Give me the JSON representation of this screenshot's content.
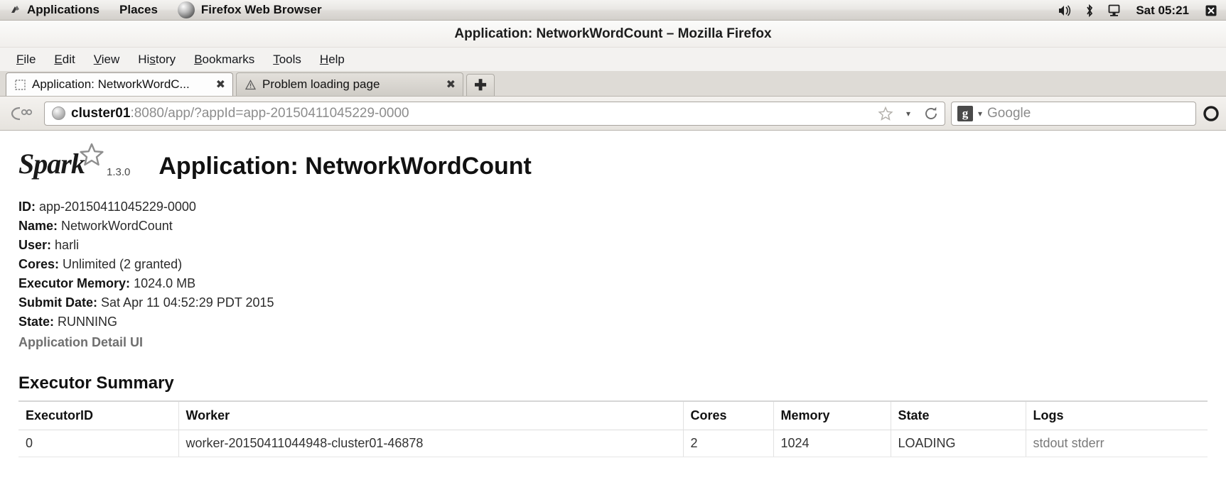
{
  "desktop": {
    "applications_label": "Applications",
    "places_label": "Places",
    "firefox_label": "Firefox Web Browser",
    "clock": "Sat 05:21",
    "tray": [
      {
        "name": "volume-icon"
      },
      {
        "name": "bluetooth-icon"
      },
      {
        "name": "display-icon"
      }
    ]
  },
  "window": {
    "title": "Application: NetworkWordCount – Mozilla Firefox"
  },
  "menubar": [
    {
      "label": "File",
      "accel": "F"
    },
    {
      "label": "Edit",
      "accel": "E"
    },
    {
      "label": "View",
      "accel": "V"
    },
    {
      "label": "History",
      "accel": "s"
    },
    {
      "label": "Bookmarks",
      "accel": "B"
    },
    {
      "label": "Tools",
      "accel": "T"
    },
    {
      "label": "Help",
      "accel": "H"
    }
  ],
  "tabs": [
    {
      "label": "Application: NetworkWordC...",
      "active": true,
      "favicon": "blank-page-icon",
      "close": "✖"
    },
    {
      "label": "Problem loading page",
      "active": false,
      "favicon": "warning-icon",
      "close": "✖"
    }
  ],
  "newtab_label": "✚",
  "navbar": {
    "back_icon": "back-arrow-icon",
    "url_host": "cluster01",
    "url_rest": ":8080/app/?appId=app-20150411045229-0000",
    "bookmark_icon": "star-icon",
    "dropdown_icon": "chevron-down-icon",
    "reload_icon": "reload-icon",
    "search_engine": "g",
    "search_placeholder": "Google"
  },
  "spark": {
    "logo_word": "Spark",
    "version": "1.3.0",
    "page_title": "Application: NetworkWordCount"
  },
  "app_info": [
    {
      "key": "ID:",
      "value": "app-20150411045229-0000"
    },
    {
      "key": "Name:",
      "value": "NetworkWordCount"
    },
    {
      "key": "User:",
      "value": "harli"
    },
    {
      "key": "Cores:",
      "value": "Unlimited (2 granted)"
    },
    {
      "key": "Executor Memory:",
      "value": "1024.0 MB"
    },
    {
      "key": "Submit Date:",
      "value": "Sat Apr 11 04:52:29 PDT 2015"
    },
    {
      "key": "State:",
      "value": "RUNNING"
    }
  ],
  "detail_ui_link": "Application Detail UI",
  "executor_summary": {
    "title": "Executor Summary",
    "columns": [
      "ExecutorID",
      "Worker",
      "Cores",
      "Memory",
      "State",
      "Logs"
    ],
    "rows": [
      {
        "executor_id": "0",
        "worker": "worker-20150411044948-cluster01-46878",
        "cores": "2",
        "memory": "1024",
        "state": "LOADING",
        "logs_stdout": "stdout",
        "logs_stderr": "stderr"
      }
    ]
  }
}
